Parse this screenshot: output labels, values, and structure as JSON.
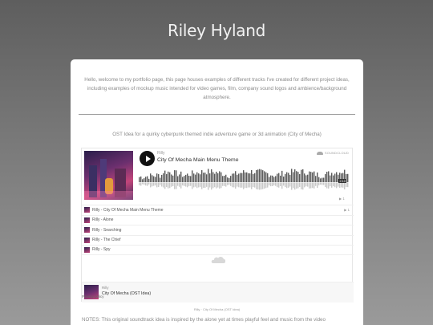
{
  "site": {
    "title": "Riley Hyland"
  },
  "intro": "Hello, welcome to my portfolio page, this page houses examples of different tracks I've created for different project ideas, including examples of mockup music intended for video games, film, company sound logos and ambience/background atmosphere.",
  "ost_title": "OST Idea for a quirky cyberpunk themed indie adventure game or 3d animation (City of Mecha)",
  "player": {
    "artist": "Rilly",
    "track_title": "City Of Mecha Main Menu Theme",
    "brand": "SOUNDCLOUD",
    "duration": "2:10",
    "plays": "1",
    "icons": {
      "play": "play-icon",
      "brand": "soundcloud-icon",
      "cover": "album-art"
    },
    "colors": {
      "waveform": "#5a5a5a",
      "waveform_reflection": "#c8c8c8",
      "play_button": "#111111"
    }
  },
  "tracks": [
    {
      "label": "Rilly - City Of Mecha Main Menu Theme",
      "plays": "1"
    },
    {
      "label": "Rilly - Alone",
      "plays": ""
    },
    {
      "label": "Rilly - Searching",
      "plays": ""
    },
    {
      "label": "Rilly - The Chief",
      "plays": ""
    },
    {
      "label": "Rilly - Spy",
      "plays": ""
    }
  ],
  "footer": {
    "artist": "Rilly",
    "title": "City Of Mecha (OST Idea)"
  },
  "privacy": "Privacy policy",
  "caption": "Rilly · City Of Mecha (OST Idea)",
  "notes": "NOTES: This original soundtrack idea is inspired by the alone yet at times playful feel and music from the video"
}
